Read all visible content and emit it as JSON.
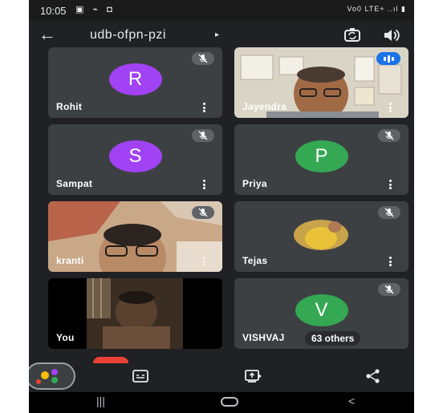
{
  "status_bar": {
    "time": "10:05",
    "icons": "▣ ⌁ ◘",
    "signal": "Vo0 LTE+ ..ıl ▮"
  },
  "header": {
    "meeting_code": "udb-ofpn-pzi",
    "arrow": "▸"
  },
  "participants": [
    {
      "name": "Rohit",
      "initial": "R",
      "avatar_color": "#a142f4",
      "muted": true
    },
    {
      "name": "Jayendra",
      "video": true,
      "speaking": true
    },
    {
      "name": "Sampat",
      "initial": "S",
      "avatar_color": "#a142f4",
      "muted": true
    },
    {
      "name": "Priya",
      "initial": "P",
      "avatar_color": "#34a853",
      "muted": true
    },
    {
      "name": "kranti",
      "video": true,
      "muted": true
    },
    {
      "name": "Tejas",
      "video": true,
      "muted": true
    },
    {
      "name": "You",
      "video": true
    },
    {
      "name": "VISHVAJ",
      "initial": "V",
      "avatar_color": "#34a853",
      "muted": true,
      "others_label": "63 others"
    }
  ],
  "nav_bar": {
    "recents": "|||",
    "back": "<"
  },
  "colors": {
    "background": "#202124",
    "tile": "#3c4043",
    "accent_blue": "#1a73e8",
    "end_call_red": "#ea4335"
  },
  "icons": [
    "back-arrow-icon",
    "camera-switch-icon",
    "speaker-icon",
    "mic-off-icon",
    "more-vert-icon",
    "audio-level-icon",
    "activities-icon",
    "captions-icon",
    "present-screen-icon",
    "share-icon",
    "recents-icon",
    "home-icon",
    "nav-back-icon"
  ]
}
